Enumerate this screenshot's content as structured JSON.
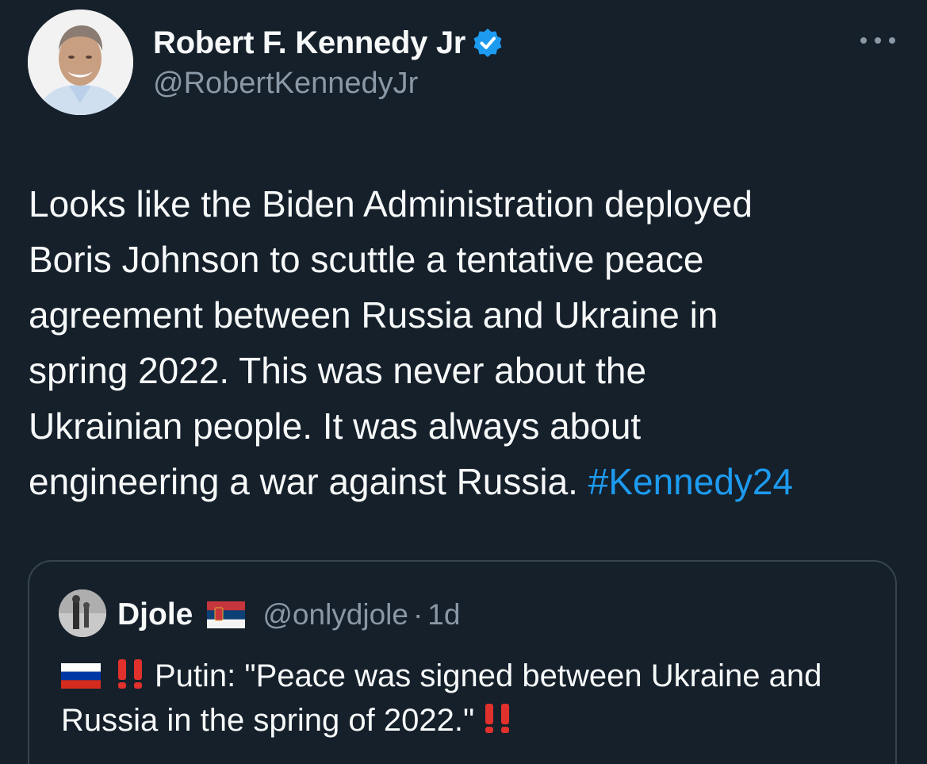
{
  "tweet": {
    "author": {
      "display_name": "Robert F. Kennedy Jr",
      "handle": "@RobertKennedyJr",
      "verified": true
    },
    "text": "Looks like the Biden Administration deployed\nBoris Johnson to scuttle a tentative peace\nagreement between Russia and Ukraine in\nspring 2022. This was never about the\nUkrainian people. It was always about\nengineering a war against Russia. ",
    "hashtag": "#Kennedy24",
    "more_icon": "more-horizontal-icon"
  },
  "quoted_tweet": {
    "author": {
      "display_name": "Djole",
      "flag": "serbia-flag",
      "handle": "@onlydjole",
      "separator": "·",
      "time": "1d"
    },
    "text": "Putin: \"Peace was signed between Ukraine and Russia in the spring of 2022.\""
  },
  "colors": {
    "background": "#15202b",
    "text": "#f7f9f9",
    "secondary": "#8b98a5",
    "link": "#1d9bf0",
    "border": "#38444d",
    "verified": "#1d9bf0"
  }
}
